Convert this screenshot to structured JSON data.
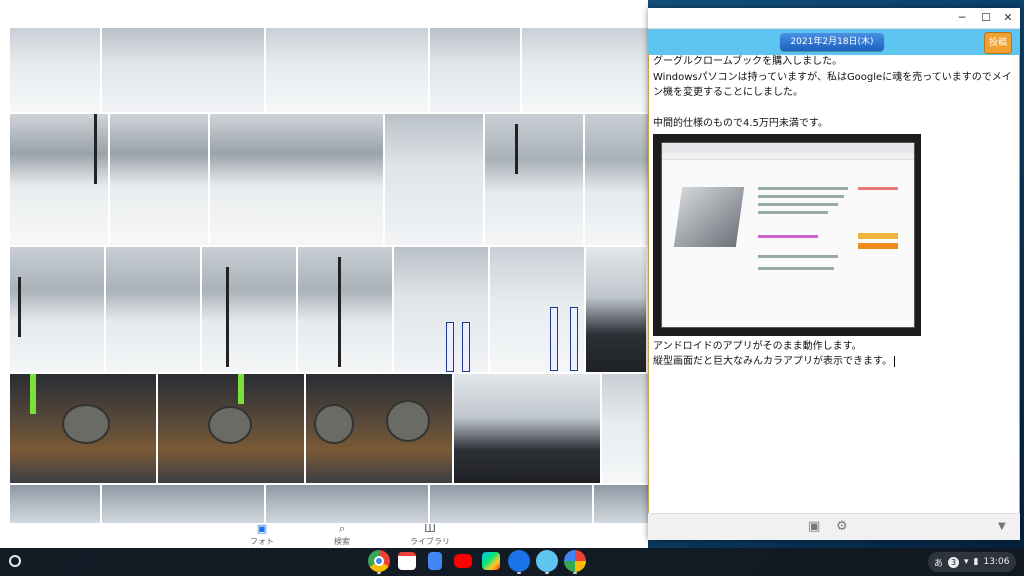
{
  "photos": {
    "nav": [
      {
        "icon": "▣",
        "label": "フォト"
      },
      {
        "icon": "⌕",
        "label": "検索"
      },
      {
        "icon": "Ш",
        "label": "ライブラリ"
      }
    ]
  },
  "editor": {
    "date": "2021年2月18日(木)",
    "post_label": "投稿",
    "controls": {
      "minimize": "─",
      "maximize": "☐",
      "close": "✕"
    },
    "paragraphs": [
      "グーグルクロームブックを購入しました。",
      "Windowsパソコンは持っていますが、私はGoogleに魂を売っていますのでメイン機を変更することにしました。",
      "中間的仕様のもので4.5万円未満です。",
      "アンドロイドのアプリがそのまま動作します。",
      "縦型画面だと巨大なみんカラアプリが表示できます。"
    ]
  },
  "shelf": {
    "ime": "あ",
    "notification_count": "3",
    "time": "13:06"
  }
}
